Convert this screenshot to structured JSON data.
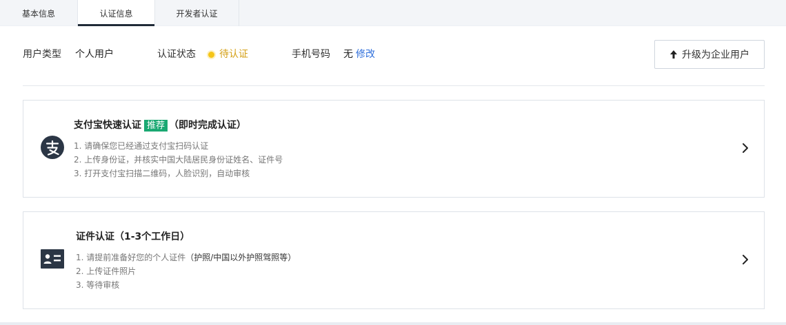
{
  "tabs": [
    {
      "label": "基本信息"
    },
    {
      "label": "认证信息"
    },
    {
      "label": "开发者认证"
    }
  ],
  "active_tab": "认证信息",
  "info": {
    "user_type_label": "用户类型",
    "user_type_value": "个人用户",
    "status_label": "认证状态",
    "status_value": "待认证",
    "phone_label": "手机号码",
    "phone_value": "无",
    "edit_link": "修改",
    "upgrade_button": "升级为企业用户"
  },
  "cards": [
    {
      "title": "支付宝快速认证",
      "tag": "推荐",
      "suffix": "（即时完成认证）",
      "steps": [
        "1. 请确保您已经通过支付宝扫码认证",
        "2. 上传身份证，并核实中国大陆居民身份证姓名、证件号",
        "3. 打开支付宝扫描二维码，人脸识别，自动审核"
      ],
      "icon": "alipay-icon"
    },
    {
      "title": "证件认证（1-3个工作日）",
      "step1_prefix": "1. 请提前准备好您的个人证件",
      "step1_hint": "（护照/中国以外护照驾照等）",
      "steps": [
        "2. 上传证件照片",
        "3. 等待审核"
      ],
      "icon": "id-card-icon"
    }
  ],
  "colors": {
    "pending": "#d4a017",
    "link": "#2f6fdb",
    "tag": "#1aa872",
    "tab_underline": "#1f2a37"
  }
}
